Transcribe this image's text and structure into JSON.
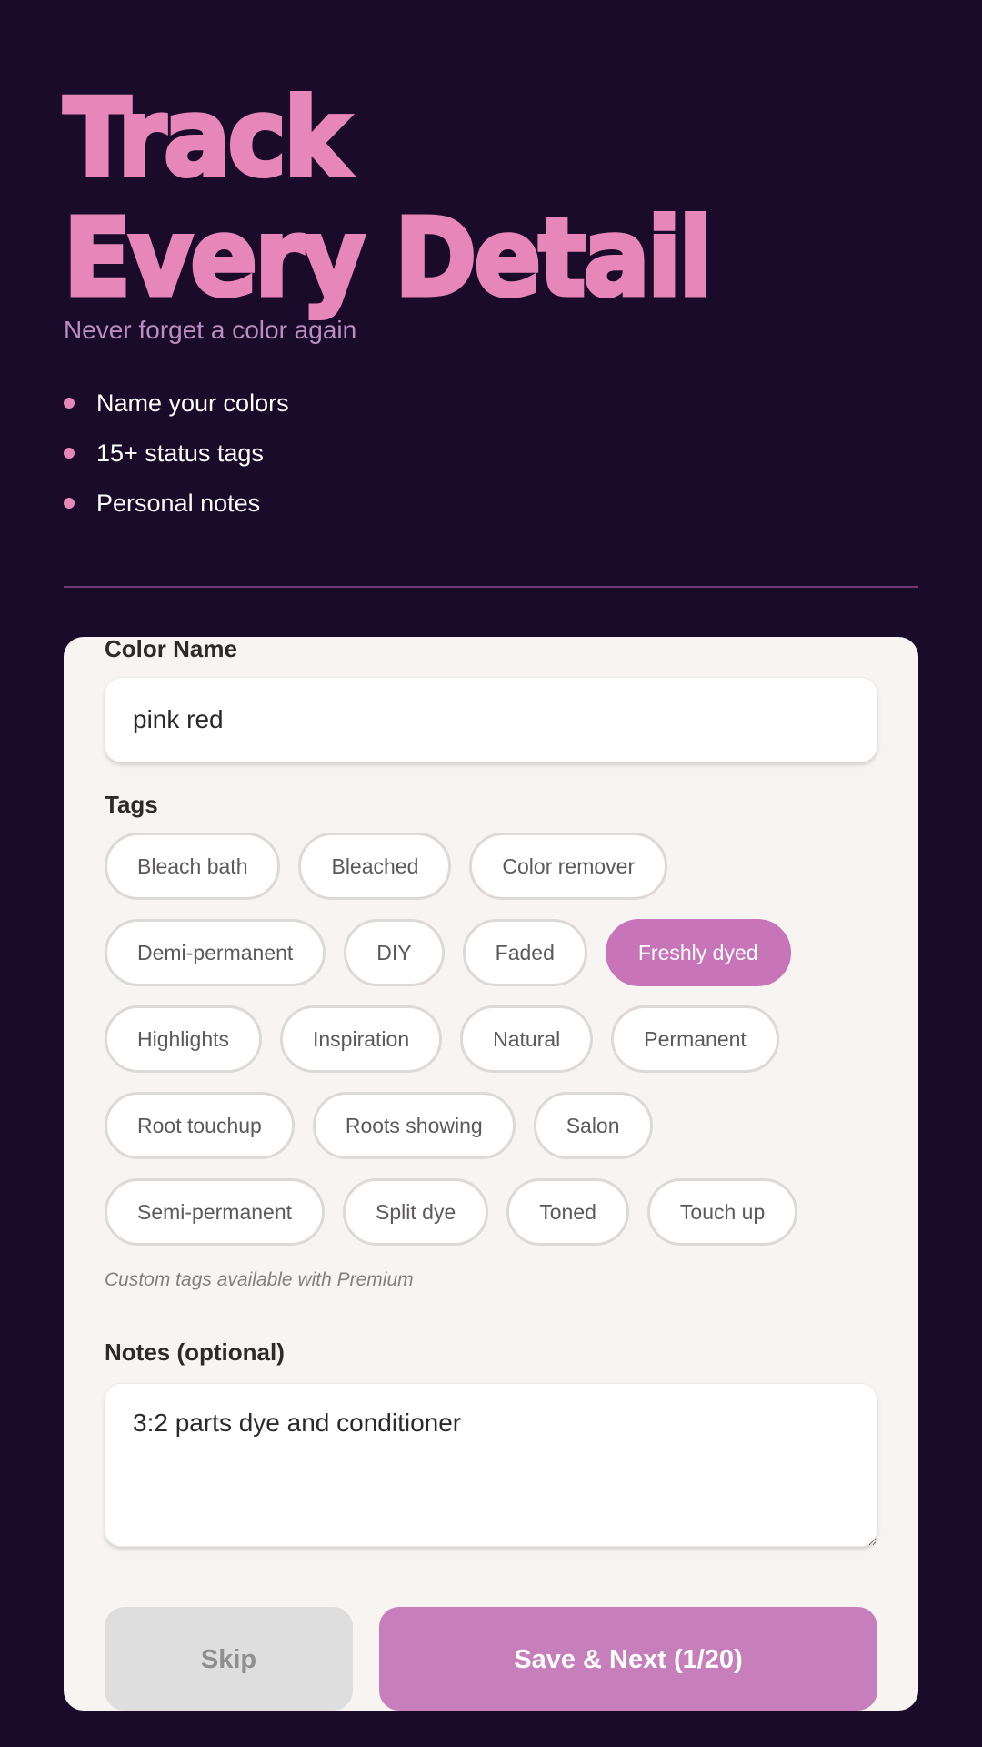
{
  "hero": {
    "title_line1": "Track",
    "title_line2": "Every Detail",
    "subtitle": "Never forget a color again",
    "features": [
      "Name your colors",
      "15+ status tags",
      "Personal notes"
    ]
  },
  "form": {
    "color_name_label": "Color Name",
    "color_name_value": "pink red",
    "tags_label": "Tags",
    "tag_rows": [
      [
        {
          "label": "Bleach bath",
          "selected": false
        },
        {
          "label": "Bleached",
          "selected": false
        },
        {
          "label": "Color remover",
          "selected": false
        }
      ],
      [
        {
          "label": "Demi-permanent",
          "selected": false
        },
        {
          "label": "DIY",
          "selected": false
        },
        {
          "label": "Faded",
          "selected": false
        },
        {
          "label": "Freshly dyed",
          "selected": true
        }
      ],
      [
        {
          "label": "Highlights",
          "selected": false
        },
        {
          "label": "Inspiration",
          "selected": false
        },
        {
          "label": "Natural",
          "selected": false
        },
        {
          "label": "Permanent",
          "selected": false
        }
      ],
      [
        {
          "label": "Root touchup",
          "selected": false
        },
        {
          "label": "Roots showing",
          "selected": false
        },
        {
          "label": "Salon",
          "selected": false
        }
      ],
      [
        {
          "label": "Semi-permanent",
          "selected": false
        },
        {
          "label": "Split dye",
          "selected": false
        },
        {
          "label": "Toned",
          "selected": false
        },
        {
          "label": "Touch up",
          "selected": false
        }
      ]
    ],
    "premium_note": "Custom tags available with Premium",
    "notes_label": "Notes (optional)",
    "notes_value": "3:2 parts dye and conditioner",
    "skip_label": "Skip",
    "save_label": "Save & Next (1/20)"
  },
  "colors": {
    "background": "#1b0b2a",
    "accent_pink": "#e786b9",
    "selected_tag": "#c774b8",
    "save_button": "#c67fbb",
    "card": "#f7f4f2"
  }
}
